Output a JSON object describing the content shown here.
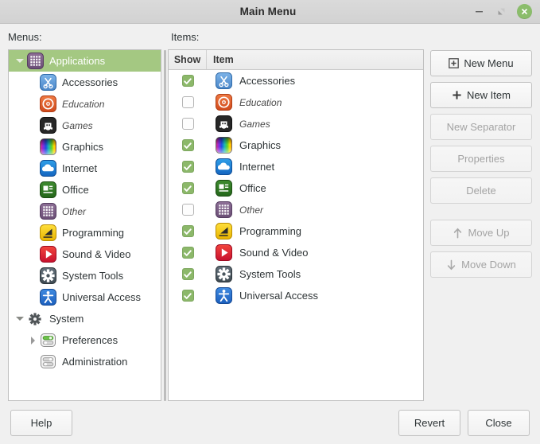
{
  "window": {
    "title": "Main Menu",
    "minimize_icon": "minimize-icon",
    "maximize_icon": "maximize-icon",
    "close_icon": "close-icon",
    "close_color": "#8bbd6b"
  },
  "labels": {
    "menus": "Menus:",
    "items": "Items:"
  },
  "tree": {
    "nodes": [
      {
        "label": "Applications",
        "icon": "grid-other-icon",
        "level": 0,
        "expander": "down",
        "selected": true,
        "italic": false
      },
      {
        "label": "Accessories",
        "icon": "accessories-icon",
        "level": 1,
        "expander": "none",
        "selected": false,
        "italic": false
      },
      {
        "label": "Education",
        "icon": "education-icon",
        "level": 1,
        "expander": "none",
        "selected": false,
        "italic": true
      },
      {
        "label": "Games",
        "icon": "games-icon",
        "level": 1,
        "expander": "none",
        "selected": false,
        "italic": true
      },
      {
        "label": "Graphics",
        "icon": "graphics-icon",
        "level": 1,
        "expander": "none",
        "selected": false,
        "italic": false
      },
      {
        "label": "Internet",
        "icon": "internet-icon",
        "level": 1,
        "expander": "none",
        "selected": false,
        "italic": false
      },
      {
        "label": "Office",
        "icon": "office-icon",
        "level": 1,
        "expander": "none",
        "selected": false,
        "italic": false
      },
      {
        "label": "Other",
        "icon": "grid-other-icon",
        "level": 1,
        "expander": "none",
        "selected": false,
        "italic": true
      },
      {
        "label": "Programming",
        "icon": "programming-icon",
        "level": 1,
        "expander": "none",
        "selected": false,
        "italic": false
      },
      {
        "label": "Sound & Video",
        "icon": "sound-video-icon",
        "level": 1,
        "expander": "none",
        "selected": false,
        "italic": false
      },
      {
        "label": "System Tools",
        "icon": "system-tools-icon",
        "level": 1,
        "expander": "none",
        "selected": false,
        "italic": false
      },
      {
        "label": "Universal Access",
        "icon": "universal-access-icon",
        "level": 1,
        "expander": "none",
        "selected": false,
        "italic": false
      },
      {
        "label": "System",
        "icon": "gear-icon",
        "level": 0,
        "expander": "down",
        "selected": false,
        "italic": false
      },
      {
        "label": "Preferences",
        "icon": "preferences-icon",
        "level": 1,
        "expander": "right",
        "selected": false,
        "italic": false
      },
      {
        "label": "Administration",
        "icon": "administration-icon",
        "level": 1,
        "expander": "none",
        "selected": false,
        "italic": false
      }
    ]
  },
  "items_table": {
    "columns": [
      "Show",
      "Item"
    ],
    "rows": [
      {
        "show": true,
        "label": "Accessories",
        "icon": "accessories-icon",
        "italic": false
      },
      {
        "show": false,
        "label": "Education",
        "icon": "education-icon",
        "italic": true
      },
      {
        "show": false,
        "label": "Games",
        "icon": "games-icon",
        "italic": true
      },
      {
        "show": true,
        "label": "Graphics",
        "icon": "graphics-icon",
        "italic": false
      },
      {
        "show": true,
        "label": "Internet",
        "icon": "internet-icon",
        "italic": false
      },
      {
        "show": true,
        "label": "Office",
        "icon": "office-icon",
        "italic": false
      },
      {
        "show": false,
        "label": "Other",
        "icon": "grid-other-icon",
        "italic": true
      },
      {
        "show": true,
        "label": "Programming",
        "icon": "programming-icon",
        "italic": false
      },
      {
        "show": true,
        "label": "Sound & Video",
        "icon": "sound-video-icon",
        "italic": false
      },
      {
        "show": true,
        "label": "System Tools",
        "icon": "system-tools-icon",
        "italic": false
      },
      {
        "show": true,
        "label": "Universal Access",
        "icon": "universal-access-icon",
        "italic": false
      }
    ]
  },
  "side_buttons": [
    {
      "label": "New Menu",
      "icon": "new-menu-icon",
      "disabled": false,
      "gap_above": false
    },
    {
      "label": "New Item",
      "icon": "plus-icon",
      "disabled": false,
      "gap_above": false
    },
    {
      "label": "New Separator",
      "icon": "none",
      "disabled": true,
      "gap_above": false
    },
    {
      "label": "Properties",
      "icon": "none",
      "disabled": true,
      "gap_above": false
    },
    {
      "label": "Delete",
      "icon": "none",
      "disabled": true,
      "gap_above": false
    },
    {
      "label": "Move Up",
      "icon": "arrow-up-icon",
      "disabled": true,
      "gap_above": true
    },
    {
      "label": "Move Down",
      "icon": "arrow-down-icon",
      "disabled": true,
      "gap_above": false
    }
  ],
  "bottom_buttons": {
    "help": "Help",
    "revert": "Revert",
    "close": "Close"
  },
  "colors": {
    "selection": "#a4c882",
    "checkbox_on": "#8cb86a",
    "titlebar": "#d6d6d6",
    "window_bg": "#f0f0f0"
  }
}
